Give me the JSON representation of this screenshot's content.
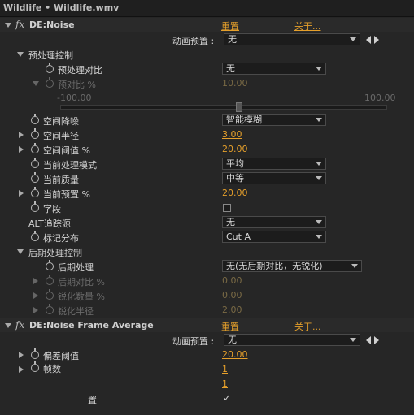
{
  "window": {
    "title": "Wildlife • Wildlife.wmv"
  },
  "effects": [
    {
      "fx_symbol": "fx",
      "name": "DE:Noise",
      "reset_label": "重置",
      "about_label": "关于...",
      "anim_preset_label": "动画预置 :",
      "anim_preset_value": "无",
      "sections": {
        "preprocess": {
          "label": "预处理控制",
          "contrast_label": "预处理对比",
          "contrast_value": "无",
          "amount_label": "预对比 %",
          "amount_value": "10.00",
          "slider_min": "-100.00",
          "slider_max": "100.00",
          "slider_value": 10
        },
        "spatial_noise_label": "空间降噪",
        "spatial_noise_value": "智能模糊",
        "spatial_radius_label": "空间半径",
        "spatial_radius_value": "3.00",
        "spatial_threshold_label": "空间阈值 %",
        "spatial_threshold_value": "20.00",
        "current_mode_label": "当前处理模式",
        "current_mode_value": "平均",
        "current_quality_label": "当前质量",
        "current_quality_value": "中等",
        "current_preset_label": "当前预置 %",
        "current_preset_value": "20.00",
        "field_label": "字段",
        "alt_source_label": "ALT追踪源",
        "alt_source_value": "无",
        "marker_label": "标记分布",
        "marker_value": "Cut A",
        "postprocess": {
          "label": "后期处理控制",
          "post_label": "后期处理",
          "post_value": "无(无后期对比，无锐化)",
          "post_contrast_label": "后期对比 %",
          "post_contrast_value": "0.00",
          "sharpen_amount_label": "锐化数量 %",
          "sharpen_amount_value": "0.00",
          "sharpen_radius_label": "锐化半径",
          "sharpen_radius_value": "2.00"
        }
      }
    },
    {
      "fx_symbol": "fx",
      "name": "DE:Noise Frame Average",
      "reset_label": "重置",
      "about_label": "关于...",
      "anim_preset_label": "动画预置 :",
      "anim_preset_value": "无",
      "deviation_label": "偏差阈值",
      "deviation_value": "20.00",
      "frames_label": "帧数",
      "frames_value": "1",
      "value_row3": "1",
      "reset_row_label": "置",
      "checkbox_checked": true
    }
  ],
  "colors": {
    "accent": "#e6a02b",
    "background": "#262626"
  }
}
